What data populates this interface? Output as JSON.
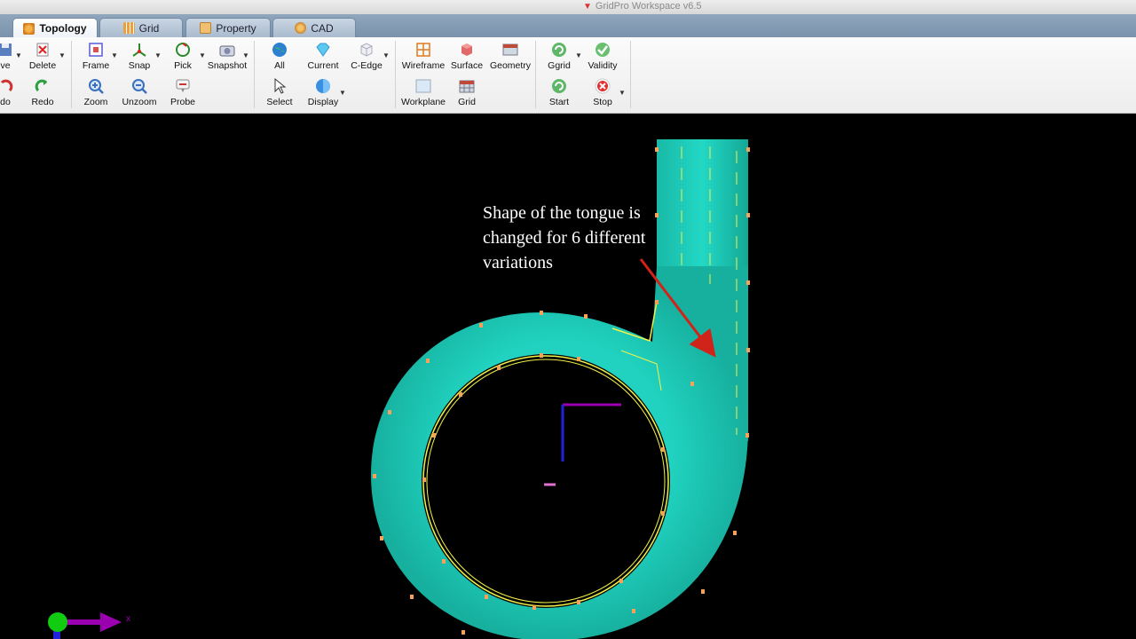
{
  "window": {
    "title": "GridPro Workspace v6.5"
  },
  "tabs": [
    {
      "label": "Topology",
      "active": true
    },
    {
      "label": "Grid"
    },
    {
      "label": "Property"
    },
    {
      "label": "CAD"
    }
  ],
  "toolbar": {
    "save": "ve",
    "delete": "Delete",
    "undo": "do",
    "redo": "Redo",
    "frame": "Frame",
    "snap": "Snap",
    "pick": "Pick",
    "snapshot": "Snapshot",
    "zoom": "Zoom",
    "unzoom": "Unzoom",
    "probe": "Probe",
    "all": "All",
    "current": "Current",
    "c_edge": "C-Edge",
    "select": "Select",
    "display": "Display",
    "wireframe": "Wireframe",
    "surface": "Surface",
    "geometry": "Geometry",
    "workplane": "Workplane",
    "grid": "Grid",
    "ggrid": "Ggrid",
    "validity": "Validity",
    "start": "Start",
    "stop": "Stop"
  },
  "viewport": {
    "annotation_lines": [
      "Shape of the tongue is",
      "changed for 6 different",
      "variations"
    ],
    "axis_label": "x",
    "colors": {
      "surface": "#1fd4c2",
      "mesh": "#f2f24a",
      "arrow": "#d0231a",
      "axis_z": "#2222dd",
      "axis_y": "#9a00b0",
      "triad_ball": "#11cc11"
    }
  }
}
